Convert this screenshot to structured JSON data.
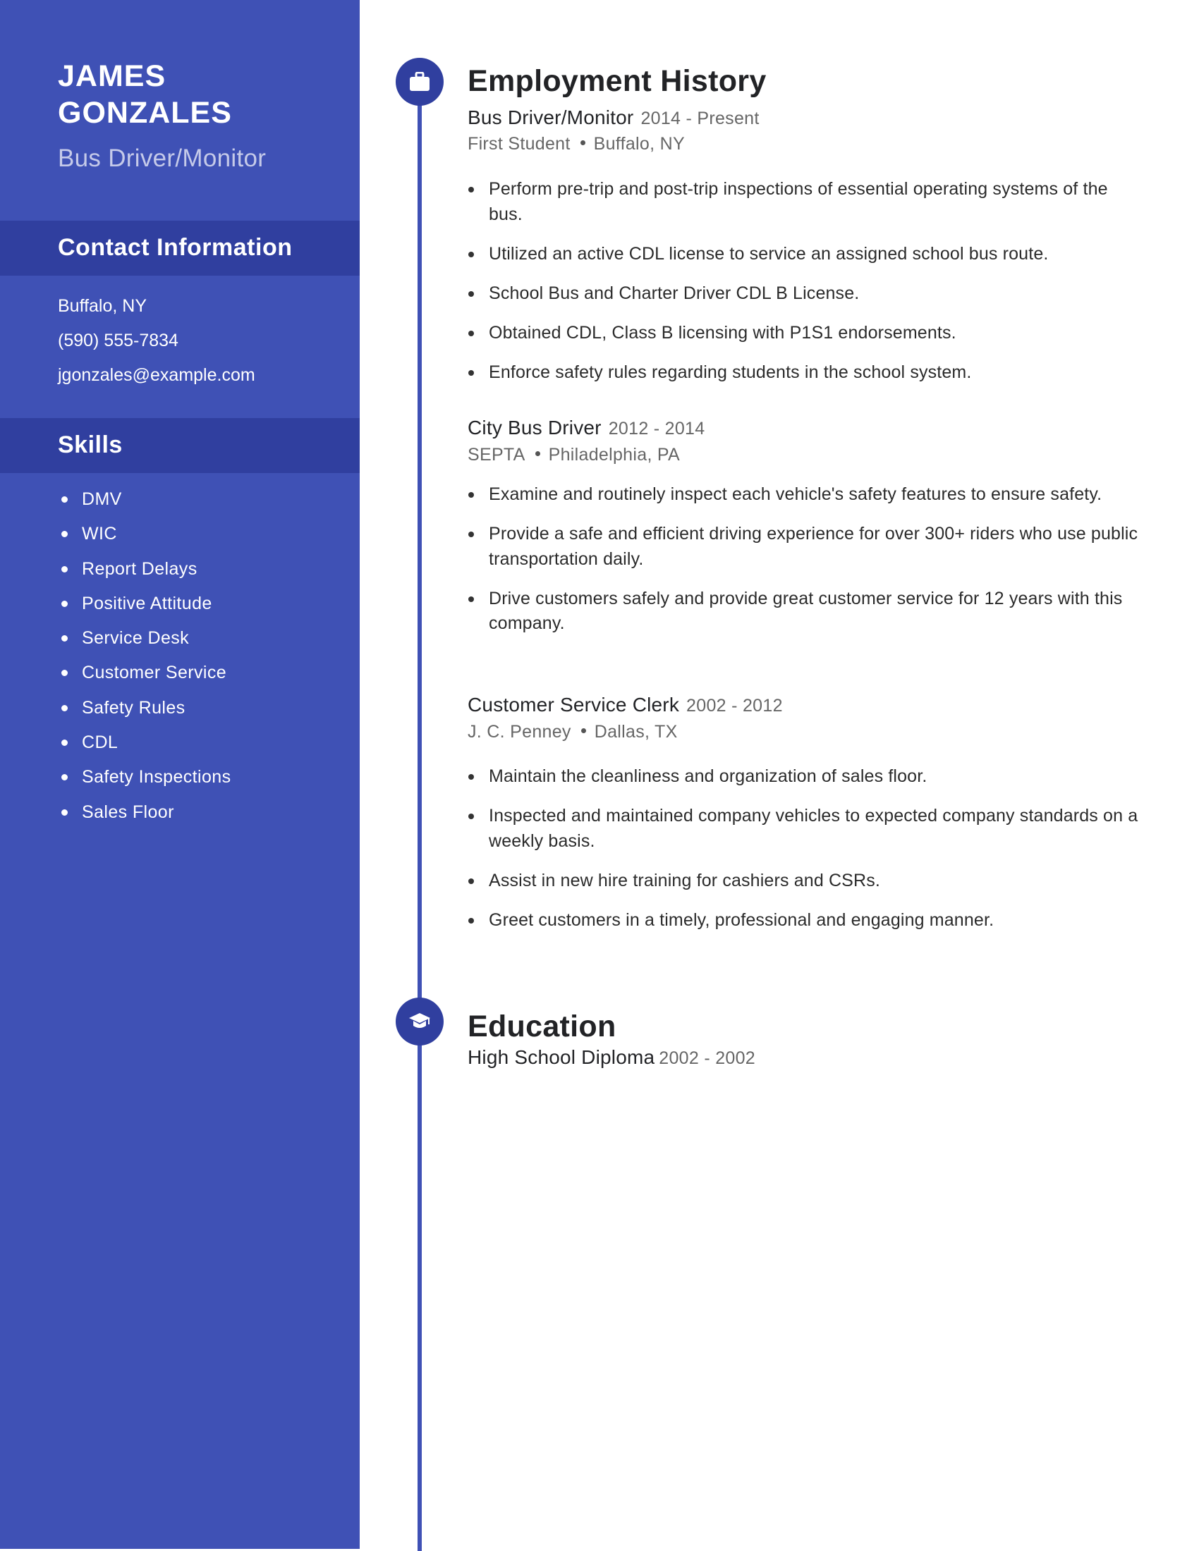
{
  "header": {
    "first_name": "JAMES",
    "last_name": "GONZALES",
    "title": "Bus Driver/Monitor"
  },
  "contact": {
    "heading": "Contact Information",
    "items": [
      "Buffalo, NY",
      "(590) 555-7834",
      "jgonzales@example.com"
    ]
  },
  "skills": {
    "heading": "Skills",
    "items": [
      "DMV",
      "WIC",
      "Report Delays",
      "Positive Attitude",
      "Service Desk",
      "Customer Service",
      "Safety Rules",
      "CDL",
      "Safety Inspections",
      "Sales Floor"
    ]
  },
  "employment": {
    "heading": "Employment History",
    "icon": "briefcase-icon",
    "jobs": [
      {
        "title": "Bus Driver/Monitor",
        "dates": "2014 - Present",
        "company": "First Student",
        "location": "Buffalo, NY",
        "bullets": [
          "Perform pre-trip and post-trip inspections of essential operating systems of the bus.",
          "Utilized an active CDL license to service an assigned school bus route.",
          "School Bus and Charter Driver CDL B License.",
          "Obtained CDL, Class B licensing with P1S1 endorsements.",
          "Enforce safety rules regarding students in the school system."
        ]
      },
      {
        "title": "City Bus Driver",
        "dates": "2012 - 2014",
        "company": "SEPTA",
        "location": "Philadelphia, PA",
        "bullets": [
          "Examine and routinely inspect each vehicle's safety features to ensure safety.",
          "Provide a safe and efficient driving experience for over 300+ riders who use public transportation daily.",
          "Drive customers safely and provide great customer service for 12 years with this company."
        ]
      },
      {
        "title": "Customer Service Clerk",
        "dates": "2002 - 2012",
        "company": "J. C. Penney",
        "location": "Dallas, TX",
        "bullets": [
          "Maintain the cleanliness and organization of sales floor.",
          "Inspected and maintained company vehicles to expected company standards on a weekly basis.",
          "Assist in new hire training for cashiers and CSRs.",
          "Greet customers in a timely, professional and engaging manner."
        ]
      }
    ]
  },
  "education": {
    "heading": "Education",
    "icon": "graduation-cap-icon",
    "items": [
      {
        "degree": "High School Diploma",
        "dates": "2002 - 2002"
      }
    ]
  },
  "colors": {
    "sidebar": "#3f51b5",
    "sidebar_band": "#303f9f",
    "title_light": "#c5cae9",
    "heading_text": "#222326",
    "muted_text": "#666666"
  }
}
